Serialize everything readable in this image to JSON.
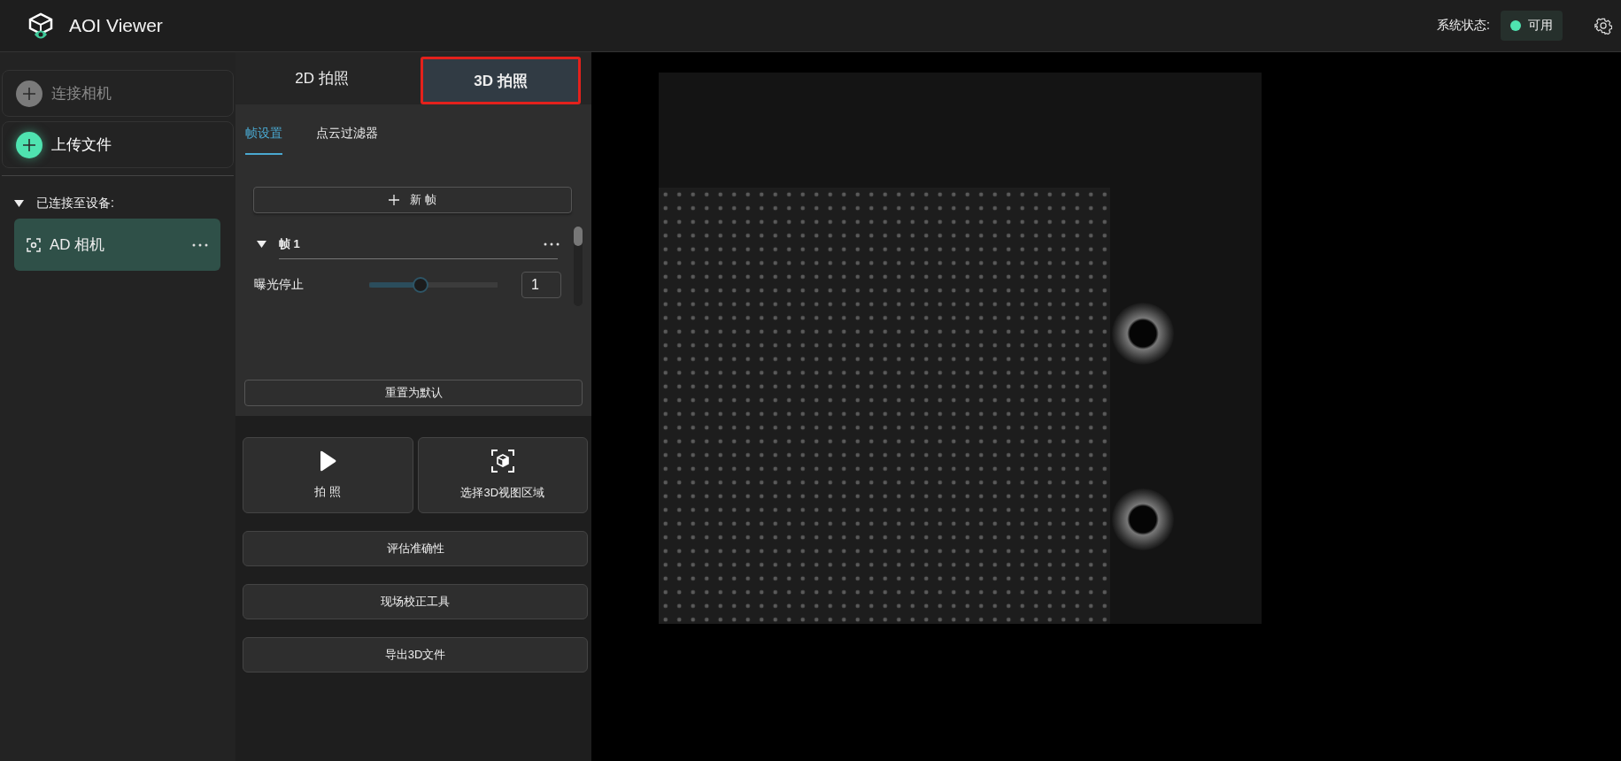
{
  "app": {
    "title": "AOI Viewer"
  },
  "status": {
    "label": "系统状态:",
    "value": "可用",
    "color": "#4fe3b0"
  },
  "sidebar": {
    "actions": [
      {
        "label": "连接相机",
        "disabled": true
      },
      {
        "label": "上传文件",
        "disabled": false
      }
    ],
    "devices": {
      "heading": "已连接至设备:",
      "expanded": true,
      "items": [
        {
          "name": "AD 相机",
          "selected": true
        }
      ]
    }
  },
  "capture_tabs": [
    {
      "label": "2D 拍照",
      "selected": false,
      "highlighted": false
    },
    {
      "label": "3D 拍照",
      "selected": true,
      "highlighted": true
    }
  ],
  "sub_tabs": [
    {
      "label": "帧设置",
      "selected": true
    },
    {
      "label": "点云过滤器",
      "selected": false
    }
  ],
  "new_frame_button": {
    "label": "新 帧"
  },
  "frames": [
    {
      "title": "帧 1",
      "expanded": true,
      "settings": [
        {
          "label": "曝光停止",
          "level": 0.4,
          "value": "1"
        }
      ]
    }
  ],
  "reset_button": {
    "label": "重置为默认"
  },
  "primary_actions": [
    {
      "label": "拍 照",
      "kind": "play"
    },
    {
      "label": "选择3D视图区域",
      "kind": "cube"
    }
  ],
  "actions": [
    {
      "label": "评估准确性"
    },
    {
      "label": "现场校正工具"
    },
    {
      "label": "导出3D文件"
    }
  ]
}
